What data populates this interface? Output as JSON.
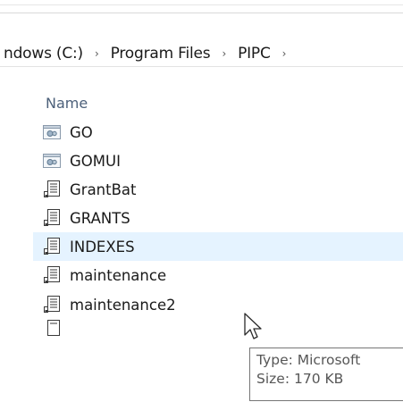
{
  "breadcrumb": {
    "items": [
      {
        "label": "ndows (C:)"
      },
      {
        "label": "Program Files"
      },
      {
        "label": "PIPC"
      }
    ],
    "separator": "›"
  },
  "list": {
    "column_header": "Name",
    "rows": [
      {
        "label": "GO",
        "icon": "application-icon",
        "state": "normal"
      },
      {
        "label": "GOMUI",
        "icon": "application-icon",
        "state": "normal"
      },
      {
        "label": "GrantBat",
        "icon": "batch-file-icon",
        "state": "normal"
      },
      {
        "label": "GRANTS",
        "icon": "batch-file-icon",
        "state": "normal"
      },
      {
        "label": "INDEXES",
        "icon": "batch-file-icon",
        "state": "hover"
      },
      {
        "label": "maintenance",
        "icon": "batch-file-icon",
        "state": "normal"
      },
      {
        "label": "maintenance2",
        "icon": "batch-file-icon",
        "state": "normal"
      }
    ]
  },
  "tooltip": {
    "type_line": "Type: Microsoft",
    "size_line": "Size: 170 KB"
  },
  "colors": {
    "hover_row": "#e5f3ff",
    "header_text": "#4c607a",
    "tooltip_border": "#767676"
  }
}
